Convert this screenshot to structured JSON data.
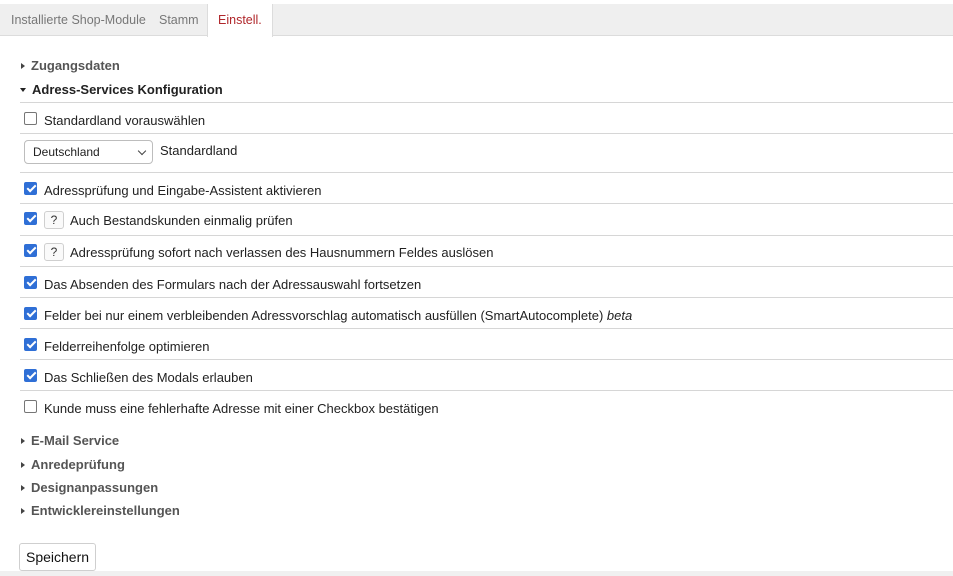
{
  "tabs": {
    "t1": "Installierte Shop-Module",
    "t2": "Stamm",
    "t3": "Einstell."
  },
  "sections": {
    "zugangsdaten": "Zugangsdaten",
    "adress": "Adress-Services Konfiguration",
    "email": "E-Mail Service",
    "anrede": "Anredeprüfung",
    "design": "Designanpassungen",
    "entwickler": "Entwicklereinstellungen"
  },
  "options": {
    "standardland_preselect": {
      "label": "Standardland vorauswählen",
      "checked": false
    },
    "country_select": {
      "value": "Deutschland",
      "label": "Standardland"
    },
    "adresspruefung": {
      "label": "Adressprüfung und Eingabe-Assistent aktivieren",
      "checked": true
    },
    "bestandskunden": {
      "label": "Auch Bestandskunden einmalig prüfen",
      "checked": true,
      "help": "?"
    },
    "hausnummer": {
      "label": "Adressprüfung sofort nach verlassen des Hausnummern Feldes auslösen",
      "checked": true,
      "help": "?"
    },
    "absenden": {
      "label": "Das Absenden des Formulars nach der Adressauswahl fortsetzen",
      "checked": true
    },
    "smartautocomplete": {
      "label": "Felder bei nur einem verbleibenden Adressvorschlag automatisch ausfüllen (SmartAutocomplete)",
      "beta": "beta",
      "checked": true
    },
    "feldreihenfolge": {
      "label": "Felderreihenfolge optimieren",
      "checked": true
    },
    "modal_schliessen": {
      "label": "Das Schließen des Modals erlauben",
      "checked": true
    },
    "fehlerhafte_adresse": {
      "label": "Kunde muss eine fehlerhafte Adresse mit einer Checkbox bestätigen",
      "checked": false
    }
  },
  "actions": {
    "save_label": "Speichern"
  },
  "colors": {
    "active_tab": "#b0272b",
    "checkbox_accent": "#2f6fd6"
  }
}
